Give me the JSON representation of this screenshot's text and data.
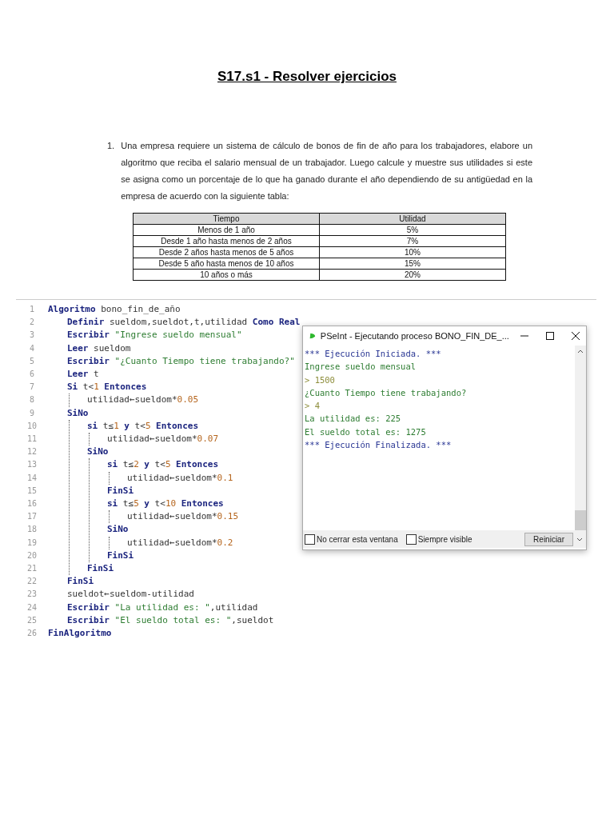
{
  "title": "S17.s1 - Resolver ejercicios",
  "question": {
    "number": "1.",
    "text": "Una empresa requiere un sistema de cálculo de bonos de fin de año para los trabajadores, elabore un algoritmo que reciba el salario mensual de un trabajador. Luego calcule y muestre sus utilidades si este se asigna como un porcentaje de lo que ha ganado durante el año dependiendo de su antigüedad en la empresa de acuerdo con la siguiente tabla:"
  },
  "table": {
    "columns": [
      "Tiempo",
      "Utilidad"
    ],
    "rows": [
      [
        "Menos de 1 año",
        "5%"
      ],
      [
        "Desde 1 año hasta menos de 2 años",
        "7%"
      ],
      [
        "Desde 2 años hasta menos de 5 años",
        "10%"
      ],
      [
        "Desde 5 año hasta menos de 10 años",
        "15%"
      ],
      [
        "10 años o más",
        "20%"
      ]
    ]
  },
  "editor": {
    "lines": [
      {
        "number": "1",
        "tokens": [
          {
            "kind": "keyword",
            "text": "Algoritmo"
          },
          {
            "kind": "plain",
            "text": " bono_fin_de_año"
          }
        ],
        "children": [
          {
            "number": "2",
            "tokens": [
              {
                "kind": "keyword",
                "text": "Definir"
              },
              {
                "kind": "plain",
                "text": " sueldom,sueldot,t,utilidad "
              },
              {
                "kind": "keyword",
                "text": "Como Real"
              }
            ]
          },
          {
            "number": "3",
            "tokens": [
              {
                "kind": "keyword",
                "text": "Escribir"
              },
              {
                "kind": "string",
                "text": " \"Ingrese sueldo mensual\""
              }
            ]
          },
          {
            "number": "4",
            "tokens": [
              {
                "kind": "keyword",
                "text": "Leer"
              },
              {
                "kind": "plain",
                "text": " sueldom"
              }
            ]
          },
          {
            "number": "5",
            "tokens": [
              {
                "kind": "keyword",
                "text": "Escribir"
              },
              {
                "kind": "string",
                "text": " \"¿Cuanto Tiempo tiene trabajando?\""
              }
            ]
          },
          {
            "number": "6",
            "tokens": [
              {
                "kind": "keyword",
                "text": "Leer"
              },
              {
                "kind": "plain",
                "text": " t"
              }
            ]
          },
          {
            "number": "7",
            "tokens": [
              {
                "kind": "keyword",
                "text": "Si"
              },
              {
                "kind": "plain",
                "text": " t<"
              },
              {
                "kind": "number",
                "text": "1"
              },
              {
                "kind": "keyword",
                "text": " Entonces"
              }
            ],
            "children": [
              {
                "number": "8",
                "tokens": [
                  {
                    "kind": "plain",
                    "text": "utilidad←sueldom*"
                  },
                  {
                    "kind": "number",
                    "text": "0.05"
                  }
                ]
              }
            ]
          },
          {
            "number": "9",
            "tokens": [
              {
                "kind": "keyword",
                "text": "SiNo"
              }
            ],
            "children": [
              {
                "number": "10",
                "tokens": [
                  {
                    "kind": "keyword",
                    "text": "si"
                  },
                  {
                    "kind": "plain",
                    "text": " t≤"
                  },
                  {
                    "kind": "number",
                    "text": "1"
                  },
                  {
                    "kind": "keyword",
                    "text": " y"
                  },
                  {
                    "kind": "plain",
                    "text": " t<"
                  },
                  {
                    "kind": "number",
                    "text": "5"
                  },
                  {
                    "kind": "keyword",
                    "text": " Entonces"
                  }
                ],
                "children": [
                  {
                    "number": "11",
                    "tokens": [
                      {
                        "kind": "plain",
                        "text": "utilidad←sueldom*"
                      },
                      {
                        "kind": "number",
                        "text": "0.07"
                      }
                    ]
                  }
                ]
              },
              {
                "number": "12",
                "tokens": [
                  {
                    "kind": "keyword",
                    "text": "SiNo"
                  }
                ],
                "children": [
                  {
                    "number": "13",
                    "tokens": [
                      {
                        "kind": "keyword",
                        "text": "si"
                      },
                      {
                        "kind": "plain",
                        "text": " t≤"
                      },
                      {
                        "kind": "number",
                        "text": "2"
                      },
                      {
                        "kind": "keyword",
                        "text": " y"
                      },
                      {
                        "kind": "plain",
                        "text": " t<"
                      },
                      {
                        "kind": "number",
                        "text": "5"
                      },
                      {
                        "kind": "keyword",
                        "text": " Entonces"
                      }
                    ],
                    "children": [
                      {
                        "number": "14",
                        "tokens": [
                          {
                            "kind": "plain",
                            "text": "utilidad←sueldom*"
                          },
                          {
                            "kind": "number",
                            "text": "0.1"
                          }
                        ]
                      }
                    ]
                  },
                  {
                    "number": "15",
                    "tokens": [
                      {
                        "kind": "keyword",
                        "text": "FinSi"
                      }
                    ]
                  },
                  {
                    "number": "16",
                    "tokens": [
                      {
                        "kind": "keyword",
                        "text": "si"
                      },
                      {
                        "kind": "plain",
                        "text": " t≤"
                      },
                      {
                        "kind": "number",
                        "text": "5"
                      },
                      {
                        "kind": "keyword",
                        "text": " y"
                      },
                      {
                        "kind": "plain",
                        "text": " t<"
                      },
                      {
                        "kind": "number",
                        "text": "10"
                      },
                      {
                        "kind": "keyword",
                        "text": " Entonces"
                      }
                    ],
                    "children": [
                      {
                        "number": "17",
                        "tokens": [
                          {
                            "kind": "plain",
                            "text": "utilidad←sueldom*"
                          },
                          {
                            "kind": "number",
                            "text": "0.15"
                          }
                        ]
                      }
                    ]
                  },
                  {
                    "number": "18",
                    "tokens": [
                      {
                        "kind": "keyword",
                        "text": "SiNo"
                      }
                    ],
                    "children": [
                      {
                        "number": "19",
                        "tokens": [
                          {
                            "kind": "plain",
                            "text": "utilidad←sueldom*"
                          },
                          {
                            "kind": "number",
                            "text": "0.2"
                          }
                        ]
                      }
                    ]
                  },
                  {
                    "number": "20",
                    "tokens": [
                      {
                        "kind": "keyword",
                        "text": "FinSi"
                      }
                    ]
                  }
                ]
              },
              {
                "number": "21",
                "tokens": [
                  {
                    "kind": "keyword",
                    "text": "FinSi"
                  }
                ]
              }
            ]
          },
          {
            "number": "22",
            "tokens": [
              {
                "kind": "keyword",
                "text": "FinSi"
              }
            ]
          },
          {
            "number": "23",
            "tokens": [
              {
                "kind": "plain",
                "text": "sueldot←sueldom-utilidad"
              }
            ]
          },
          {
            "number": "24",
            "tokens": [
              {
                "kind": "keyword",
                "text": "Escribir"
              },
              {
                "kind": "string",
                "text": " \"La utilidad es: \""
              },
              {
                "kind": "plain",
                "text": ",utilidad"
              }
            ]
          },
          {
            "number": "25",
            "tokens": [
              {
                "kind": "keyword",
                "text": "Escribir"
              },
              {
                "kind": "string",
                "text": " \"El sueldo total es: \""
              },
              {
                "kind": "plain",
                "text": ",sueldot"
              }
            ]
          }
        ]
      },
      {
        "number": "26",
        "tokens": [
          {
            "kind": "keyword",
            "text": "FinAlgoritmo"
          }
        ]
      }
    ]
  },
  "window": {
    "title": "PSeInt - Ejecutando proceso BONO_FIN_DE_...",
    "console": [
      {
        "kind": "system",
        "text": "*** Ejecución Iniciada. ***"
      },
      {
        "kind": "output",
        "text": "Ingrese sueldo mensual"
      },
      {
        "kind": "input",
        "text": "> 1500"
      },
      {
        "kind": "output",
        "text": "¿Cuanto Tiempo tiene trabajando?"
      },
      {
        "kind": "input",
        "text": "> 4"
      },
      {
        "kind": "output",
        "text": "La utilidad es: 225"
      },
      {
        "kind": "output",
        "text": "El sueldo total es: 1275"
      },
      {
        "kind": "system",
        "text": "*** Ejecución Finalizada. ***"
      }
    ],
    "options": [
      {
        "label": "No cerrar esta ventana",
        "checked": false
      },
      {
        "label": "Siempre visible",
        "checked": false
      }
    ],
    "button": "Reiniciar"
  }
}
